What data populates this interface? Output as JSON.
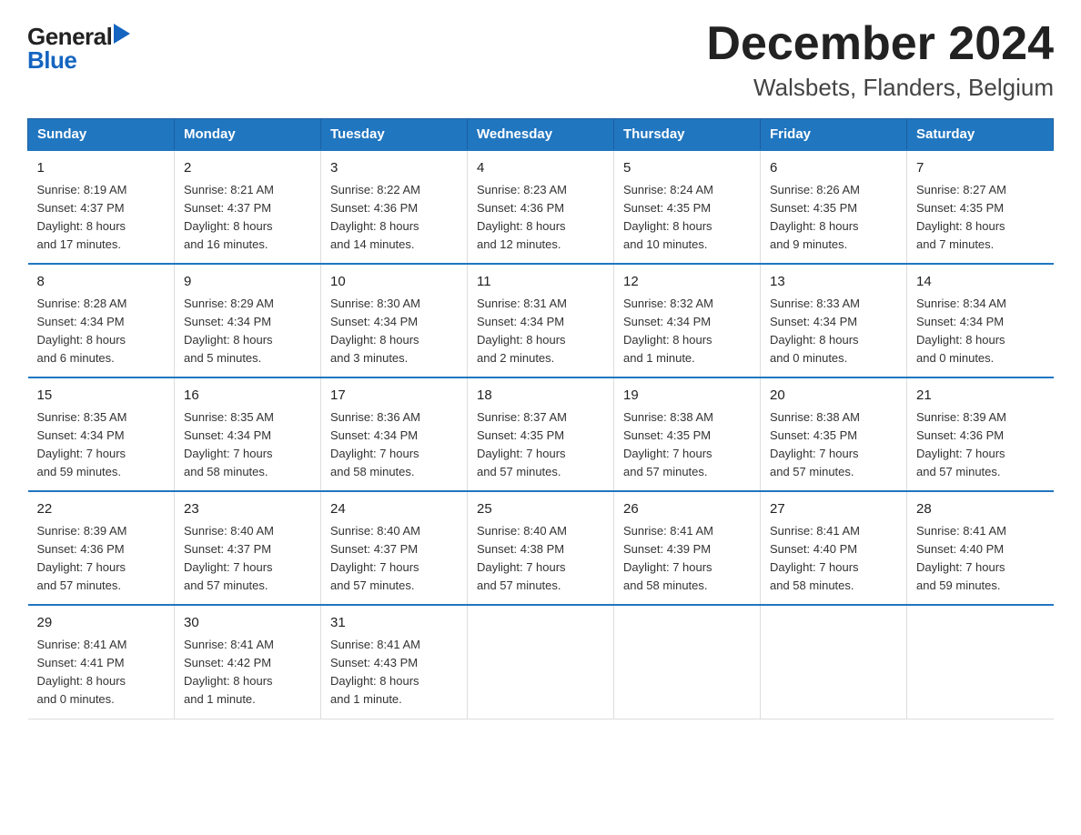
{
  "logo": {
    "general": "General",
    "arrow": "▶",
    "blue": "Blue"
  },
  "title": "December 2024",
  "subtitle": "Walsbets, Flanders, Belgium",
  "days_of_week": [
    "Sunday",
    "Monday",
    "Tuesday",
    "Wednesday",
    "Thursday",
    "Friday",
    "Saturday"
  ],
  "weeks": [
    [
      {
        "num": "1",
        "info": "Sunrise: 8:19 AM\nSunset: 4:37 PM\nDaylight: 8 hours\nand 17 minutes."
      },
      {
        "num": "2",
        "info": "Sunrise: 8:21 AM\nSunset: 4:37 PM\nDaylight: 8 hours\nand 16 minutes."
      },
      {
        "num": "3",
        "info": "Sunrise: 8:22 AM\nSunset: 4:36 PM\nDaylight: 8 hours\nand 14 minutes."
      },
      {
        "num": "4",
        "info": "Sunrise: 8:23 AM\nSunset: 4:36 PM\nDaylight: 8 hours\nand 12 minutes."
      },
      {
        "num": "5",
        "info": "Sunrise: 8:24 AM\nSunset: 4:35 PM\nDaylight: 8 hours\nand 10 minutes."
      },
      {
        "num": "6",
        "info": "Sunrise: 8:26 AM\nSunset: 4:35 PM\nDaylight: 8 hours\nand 9 minutes."
      },
      {
        "num": "7",
        "info": "Sunrise: 8:27 AM\nSunset: 4:35 PM\nDaylight: 8 hours\nand 7 minutes."
      }
    ],
    [
      {
        "num": "8",
        "info": "Sunrise: 8:28 AM\nSunset: 4:34 PM\nDaylight: 8 hours\nand 6 minutes."
      },
      {
        "num": "9",
        "info": "Sunrise: 8:29 AM\nSunset: 4:34 PM\nDaylight: 8 hours\nand 5 minutes."
      },
      {
        "num": "10",
        "info": "Sunrise: 8:30 AM\nSunset: 4:34 PM\nDaylight: 8 hours\nand 3 minutes."
      },
      {
        "num": "11",
        "info": "Sunrise: 8:31 AM\nSunset: 4:34 PM\nDaylight: 8 hours\nand 2 minutes."
      },
      {
        "num": "12",
        "info": "Sunrise: 8:32 AM\nSunset: 4:34 PM\nDaylight: 8 hours\nand 1 minute."
      },
      {
        "num": "13",
        "info": "Sunrise: 8:33 AM\nSunset: 4:34 PM\nDaylight: 8 hours\nand 0 minutes."
      },
      {
        "num": "14",
        "info": "Sunrise: 8:34 AM\nSunset: 4:34 PM\nDaylight: 8 hours\nand 0 minutes."
      }
    ],
    [
      {
        "num": "15",
        "info": "Sunrise: 8:35 AM\nSunset: 4:34 PM\nDaylight: 7 hours\nand 59 minutes."
      },
      {
        "num": "16",
        "info": "Sunrise: 8:35 AM\nSunset: 4:34 PM\nDaylight: 7 hours\nand 58 minutes."
      },
      {
        "num": "17",
        "info": "Sunrise: 8:36 AM\nSunset: 4:34 PM\nDaylight: 7 hours\nand 58 minutes."
      },
      {
        "num": "18",
        "info": "Sunrise: 8:37 AM\nSunset: 4:35 PM\nDaylight: 7 hours\nand 57 minutes."
      },
      {
        "num": "19",
        "info": "Sunrise: 8:38 AM\nSunset: 4:35 PM\nDaylight: 7 hours\nand 57 minutes."
      },
      {
        "num": "20",
        "info": "Sunrise: 8:38 AM\nSunset: 4:35 PM\nDaylight: 7 hours\nand 57 minutes."
      },
      {
        "num": "21",
        "info": "Sunrise: 8:39 AM\nSunset: 4:36 PM\nDaylight: 7 hours\nand 57 minutes."
      }
    ],
    [
      {
        "num": "22",
        "info": "Sunrise: 8:39 AM\nSunset: 4:36 PM\nDaylight: 7 hours\nand 57 minutes."
      },
      {
        "num": "23",
        "info": "Sunrise: 8:40 AM\nSunset: 4:37 PM\nDaylight: 7 hours\nand 57 minutes."
      },
      {
        "num": "24",
        "info": "Sunrise: 8:40 AM\nSunset: 4:37 PM\nDaylight: 7 hours\nand 57 minutes."
      },
      {
        "num": "25",
        "info": "Sunrise: 8:40 AM\nSunset: 4:38 PM\nDaylight: 7 hours\nand 57 minutes."
      },
      {
        "num": "26",
        "info": "Sunrise: 8:41 AM\nSunset: 4:39 PM\nDaylight: 7 hours\nand 58 minutes."
      },
      {
        "num": "27",
        "info": "Sunrise: 8:41 AM\nSunset: 4:40 PM\nDaylight: 7 hours\nand 58 minutes."
      },
      {
        "num": "28",
        "info": "Sunrise: 8:41 AM\nSunset: 4:40 PM\nDaylight: 7 hours\nand 59 minutes."
      }
    ],
    [
      {
        "num": "29",
        "info": "Sunrise: 8:41 AM\nSunset: 4:41 PM\nDaylight: 8 hours\nand 0 minutes."
      },
      {
        "num": "30",
        "info": "Sunrise: 8:41 AM\nSunset: 4:42 PM\nDaylight: 8 hours\nand 1 minute."
      },
      {
        "num": "31",
        "info": "Sunrise: 8:41 AM\nSunset: 4:43 PM\nDaylight: 8 hours\nand 1 minute."
      },
      {
        "num": "",
        "info": ""
      },
      {
        "num": "",
        "info": ""
      },
      {
        "num": "",
        "info": ""
      },
      {
        "num": "",
        "info": ""
      }
    ]
  ]
}
